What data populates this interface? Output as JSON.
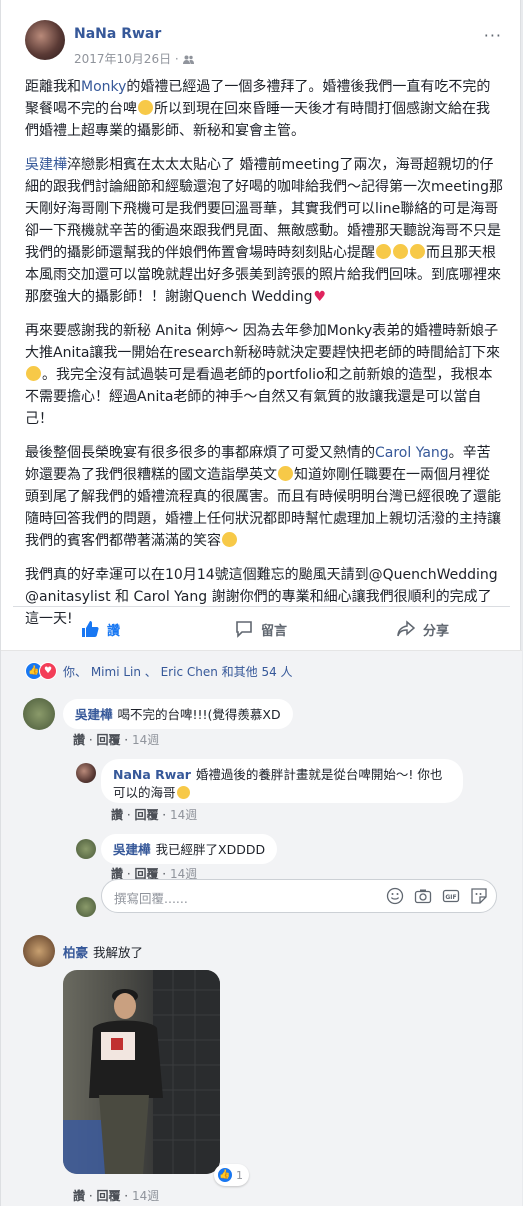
{
  "post": {
    "author": "NaNa Rwar",
    "date": "2017年10月26日 · ",
    "audience_icon": "friends-icon",
    "more_label": "···"
  },
  "body": {
    "p1a": "距離我和",
    "p1_link": "Monky",
    "p1b": "的婚禮已經過了一個多禮拜了。婚禮後我們一直有吃不完的聚餐喝不完的台啤",
    "p1c": "所以到現在回來昏睡一天後才有時間打個感謝文給在我們婚禮上超專業的攝影師、新秘和宴會主管。",
    "p2_link": "吳建樺",
    "p2a": "淬戀影相賓在太太太貼心了 婚禮前meeting了兩次，海哥超親切的仔細的跟我們討論細節和經驗還泡了好喝的咖啡給我們～記得第一次meeting那天剛好海哥剛下飛機可是我們要回溫哥華，其實我們可以line聯絡的可是海哥卻一下飛機就辛苦的衝過來跟我們見面、無敵感動。婚禮那天聽說海哥不只是我們的攝影師還幫我的伴娘們佈置會場時時刻刻貼心提醒",
    "p2b": "而且那天根本風雨交加還可以當晚就趕出好多張美到誇張的照片給我們回味。到底哪裡來那麼強大的攝影師！！謝謝Quench Wedding",
    "p3a": "再來要感謝我的新秘 Anita 俐婷～ 因為去年參加Monky表弟的婚禮時新娘子大推Anita讓我一開始在research新秘時就決定要趕快把老師的時間給訂下來",
    "p3b": "。我完全沒有試過裝可是看過老師的portfolio和之前新娘的造型，我根本不需要擔心！經過Anita老師的神手～自然又有氣質的妝讓我還是可以當自己！",
    "p4a": "最後整個長榮晚宴有很多很多的事都麻煩了可愛又熱情的",
    "p4_link": "Carol Yang",
    "p4b": "。辛苦妳還要為了我們很糟糕的國文造詣學英文",
    "p4c": "知道妳剛任職要在一兩個月裡從頭到尾了解我們的婚禮流程真的很厲害。而且有時候明明台灣已經很晚了還能隨時回答我們的問題，婚禮上任何狀況都即時幫忙處理加上親切活潑的主持讓我們的賓客們都帶著滿滿的笑容",
    "p5": "我們真的好幸運可以在10月14號這個難忘的颱風天請到@QuenchWedding @anitasylist 和 Carol Yang 謝謝你們的專業和細心讓我們很順利的完成了這一天!"
  },
  "actions": {
    "like": "讚",
    "comment": "留言",
    "share": "分享"
  },
  "reactions": {
    "text": "你、 Mimi Lin 、 Eric Chen 和其他 54 人"
  },
  "comments": [
    {
      "name": "吳建樺",
      "text": "喝不完的台啤!!!(覺得羨慕XD",
      "like": "讚",
      "reply": "回覆",
      "time": "14週"
    },
    {
      "name": "NaNa Rwar",
      "text": "婚禮過後的養胖計畫就是從台啤開始～! 你也可以的海哥",
      "like": "讚",
      "reply": "回覆",
      "time": "14週"
    },
    {
      "name": "吳建樺",
      "text": "我已經胖了XDDDD",
      "like": "讚",
      "reply": "回覆",
      "time": "14週"
    },
    {
      "name": "柏豪",
      "text": "我解放了",
      "like": "讚",
      "reply": "回覆",
      "time": "14週",
      "reaction_count": "1"
    }
  ],
  "reply_box": {
    "placeholder": "撰寫回覆......"
  },
  "colors": {
    "link": "#365899",
    "like_blue": "#1877f2",
    "love_red": "#f33e58",
    "bg": "#f2f3f5"
  }
}
